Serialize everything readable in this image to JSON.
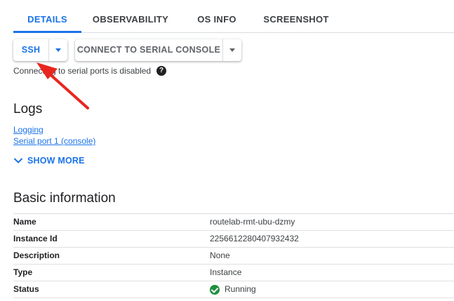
{
  "tabs": [
    {
      "label": "DETAILS",
      "active": true
    },
    {
      "label": "OBSERVABILITY",
      "active": false
    },
    {
      "label": "OS INFO",
      "active": false
    },
    {
      "label": "SCREENSHOT",
      "active": false
    }
  ],
  "buttons": {
    "ssh": "SSH",
    "serial_console": "CONNECT TO SERIAL CONSOLE"
  },
  "serial_notice": "Connecting to serial ports is disabled",
  "logs": {
    "heading": "Logs",
    "links": [
      "Logging",
      "Serial port 1 (console)"
    ],
    "show_more": "SHOW MORE"
  },
  "basic_info": {
    "heading": "Basic information",
    "rows": [
      {
        "key": "Name",
        "value": "routelab-rmt-ubu-dzmy"
      },
      {
        "key": "Instance Id",
        "value": "2256612280407932432"
      },
      {
        "key": "Description",
        "value": "None"
      },
      {
        "key": "Type",
        "value": "Instance"
      },
      {
        "key": "Status",
        "value": "Running"
      }
    ]
  },
  "colors": {
    "accent": "#1a73e8",
    "status_ok": "#1e8e3e",
    "annotation_arrow": "#e8261f"
  },
  "icons": [
    "chevron-down-icon",
    "help-icon",
    "check-circle-icon",
    "annotation-arrow"
  ]
}
